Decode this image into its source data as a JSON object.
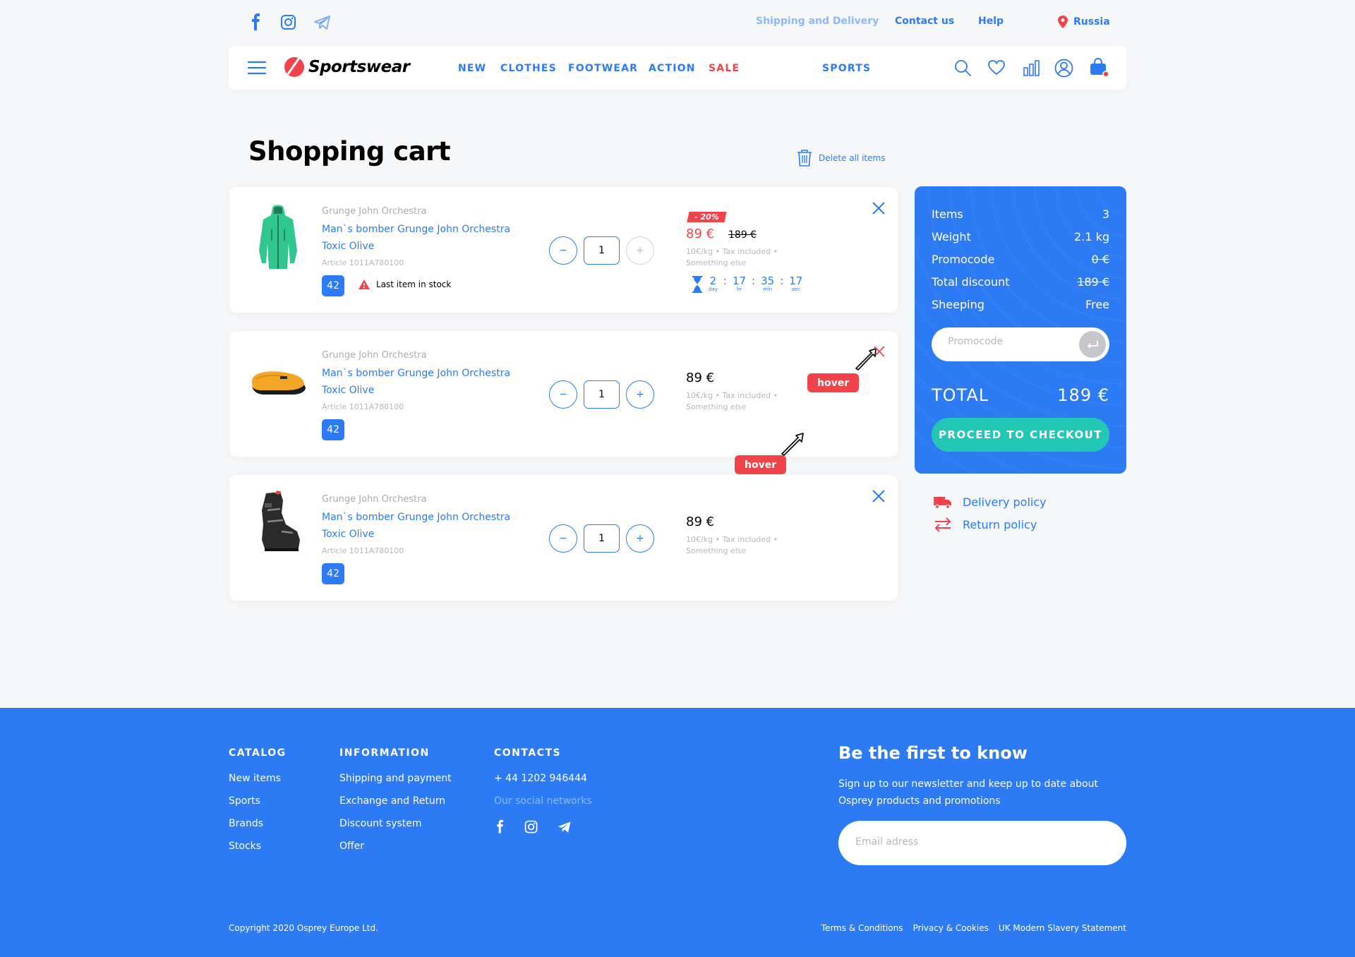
{
  "topbar": {
    "social_icons": [
      "facebook-icon",
      "instagram-icon",
      "telegram-icon"
    ],
    "shipping_link": "Shipping and Delivery",
    "contact_link": "Contact us",
    "help_link": "Help",
    "region": "Russia"
  },
  "header": {
    "logo": "Sportswear",
    "nav": [
      "NEW",
      "CLOTHES",
      "FOOTWEAR",
      "ACTION",
      "SALE",
      "SPORTS"
    ],
    "icons": [
      "search-icon",
      "heart-icon",
      "stats-icon",
      "user-icon",
      "bag-icon"
    ]
  },
  "cart": {
    "title": "Shopping cart",
    "delete_all": "Delete all items",
    "items": [
      {
        "brand": "Grunge John Orchestra",
        "name_line1": "Man`s bomber Grunge John Orchestra",
        "name_line2": "Toxic Olive",
        "article": "Article 1011A780100",
        "size": "42",
        "stock_note": "Last item in stock",
        "quantity": "1",
        "minus": "−",
        "plus": "+",
        "discount_badge": "- 20%",
        "price": "89 €",
        "old_price": "189 €",
        "price_info_line1": "10€/kg • Tax included •",
        "price_info_line2": "Something else",
        "timer": [
          {
            "value": "2",
            "unit": "day"
          },
          {
            "value": "17",
            "unit": "hr"
          },
          {
            "value": "35",
            "unit": "min"
          },
          {
            "value": "17",
            "unit": "sec"
          }
        ]
      },
      {
        "brand": "Grunge John Orchestra",
        "name_line1": "Man`s bomber Grunge John Orchestra",
        "name_line2": "Toxic Olive",
        "article": "Article 1011A780100",
        "size": "42",
        "quantity": "1",
        "minus": "−",
        "plus": "+",
        "price": "89 €",
        "price_info_line1": "10€/kg • Tax included •",
        "price_info_line2": "Something else"
      },
      {
        "brand": "Grunge John Orchestra",
        "name_line1": "Man`s bomber Grunge John Orchestra",
        "name_line2": "Toxic Olive",
        "article": "Article 1011A780100",
        "size": "42",
        "quantity": "1",
        "minus": "−",
        "plus": "+",
        "price": "89 €",
        "price_info_line1": "10€/kg • Tax included •",
        "price_info_line2": "Something else"
      }
    ],
    "hover_label": "hover"
  },
  "summary": {
    "rows": [
      {
        "label": "Items",
        "value": "3"
      },
      {
        "label": "Weight",
        "value": "2.1 kg"
      },
      {
        "label": "Promocode",
        "value": "0 €"
      },
      {
        "label": "Total discount",
        "value": "189 €"
      },
      {
        "label": "Sheeping",
        "value": "Free"
      }
    ],
    "promo_placeholder": "Promocode",
    "total_label": "TOTAL",
    "total_value": "189 €",
    "checkout": "PROCEED TO CHECKOUT"
  },
  "policies": {
    "delivery": "Delivery policy",
    "return": "Return policy"
  },
  "footer": {
    "catalog": {
      "title": "CATALOG",
      "links": [
        "New items",
        "Sports",
        "Brands",
        "Stocks"
      ]
    },
    "information": {
      "title": "INFORMATION",
      "links": [
        "Shipping and payment",
        "Exchange and Return",
        "Discount system",
        "Offer"
      ]
    },
    "contacts": {
      "title": "CONTACTS",
      "phone": "+ 44 1202 946444",
      "social_label": "Our social networks"
    },
    "newsletter": {
      "title": "Be the first to know",
      "text_line1": "Sign up to our newsletter and keep up to date about",
      "text_line2": "Osprey products and promotions",
      "email_placeholder": "Email adress"
    },
    "copyright": "Copyright 2020 Osprey Europe Ltd.",
    "legal": [
      "Terms & Conditions",
      "Privacy & Cookies",
      "UK Modern Slavery Statement"
    ]
  },
  "colors": {
    "accent": "#2d7bf4",
    "sale": "#f0444a",
    "checkout": "#22c7b6",
    "background": "#f6f7f9"
  }
}
